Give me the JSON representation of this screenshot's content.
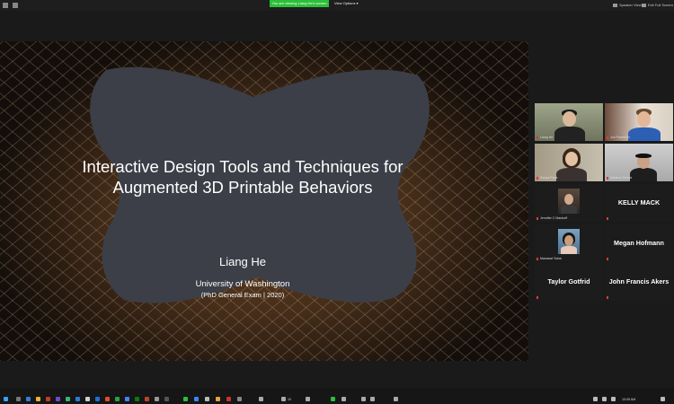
{
  "banner": {
    "text": "You are viewing Liang He's screen",
    "color": "#2dbf3a"
  },
  "view_options": "View Options ▾",
  "top_right": {
    "speaker_view": "Speaker View",
    "exit_fullscreen": "Exit Full Screen"
  },
  "slide": {
    "title_line1": "Interactive Design Tools and Techniques for",
    "title_line2": "Augmented 3D Printable Behaviors",
    "author": "Liang He",
    "university": "University of Washington",
    "exam": "(PhD General Exam | 2020)"
  },
  "participants": [
    {
      "name": "Liang He",
      "type": "video",
      "active": true
    },
    {
      "name": "Jon Froehlich",
      "type": "video"
    },
    {
      "name": "Sonya Pauk",
      "type": "video"
    },
    {
      "name": "Adriana Schulz",
      "type": "video"
    },
    {
      "name": "Jennifer C Mankoff",
      "type": "photo",
      "emoji": "👍"
    },
    {
      "name": "KELLY MACK",
      "type": "name"
    },
    {
      "name": "Manaswi Saha",
      "type": "photo"
    },
    {
      "name": "Megan Hofmann",
      "type": "name"
    },
    {
      "name": "Taylor Gotfrid",
      "type": "name"
    },
    {
      "name": "John Francis Akers",
      "type": "name"
    }
  ],
  "taskbar": {
    "participants_count": "10",
    "time": "10:05 AM"
  }
}
